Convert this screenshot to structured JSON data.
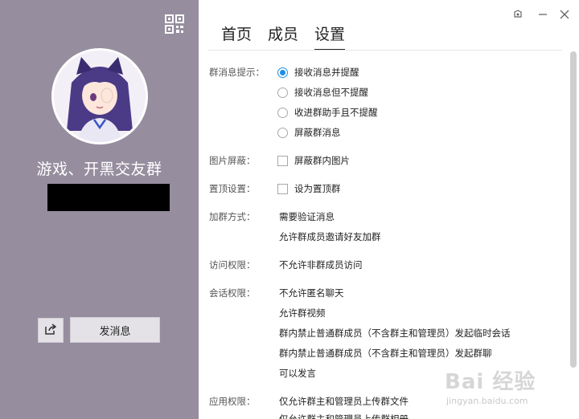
{
  "group": {
    "name": "游戏、开黑交友群"
  },
  "actions": {
    "send_label": "发消息"
  },
  "tabs": [
    {
      "label": "首页"
    },
    {
      "label": "成员"
    },
    {
      "label": "设置"
    }
  ],
  "active_tab": "设置",
  "settings": {
    "msg_notify": {
      "label": "群消息提示：",
      "options": [
        {
          "label": "接收消息并提醒",
          "selected": true
        },
        {
          "label": "接收消息但不提醒",
          "selected": false
        },
        {
          "label": "收进群助手且不提醒",
          "selected": false
        },
        {
          "label": "屏蔽群消息",
          "selected": false
        }
      ]
    },
    "image_block": {
      "label": "图片屏蔽：",
      "option": "屏蔽群内图片",
      "checked": false
    },
    "pin": {
      "label": "置顶设置：",
      "option": "设为置顶群",
      "checked": false
    },
    "join": {
      "label": "加群方式：",
      "values": [
        "需要验证消息",
        "允许群成员邀请好友加群"
      ]
    },
    "access": {
      "label": "访问权限：",
      "values": [
        "不允许非群成员访问"
      ]
    },
    "session": {
      "label": "会话权限：",
      "values": [
        "不允许匿名聊天",
        "允许群视频",
        "群内禁止普通群成员（不含群主和管理员）发起临时会话",
        "群内禁止普通群成员（不含群主和管理员）发起群聊",
        "可以发言"
      ]
    },
    "app": {
      "label": "应用权限：",
      "values": [
        "仅允许群主和管理员上传群文件",
        "仅允许群主和管理员上传群相册"
      ]
    }
  },
  "icons": {
    "qr": "qr-code-icon",
    "share": "share-icon",
    "skin": "skin-icon",
    "minimize": "minimize-icon",
    "close": "close-icon"
  },
  "watermark": {
    "main": "Bai 经验",
    "sub": "jingyan.baidu.com"
  },
  "colors": {
    "left_panel": "#968e9f",
    "accent": "#1e8fe6"
  }
}
